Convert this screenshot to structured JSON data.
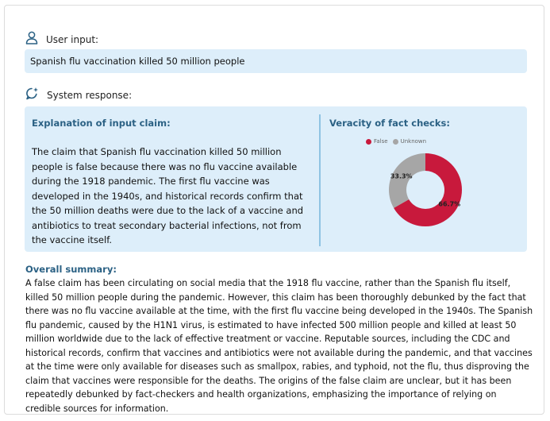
{
  "user": {
    "label": "User input:",
    "claim": "Spanish flu vaccination killed 50 million people"
  },
  "system": {
    "label": "System response:"
  },
  "explanation": {
    "title": "Explanation of input claim:",
    "text": "The claim that Spanish flu vaccination killed 50 million people is false because there was no flu vaccine available during the 1918 pandemic. The first flu vaccine was developed in the 1940s, and historical records confirm that the 50 million deaths were due to the lack of a vaccine and antibiotics to treat secondary bacterial infections, not from the vaccine itself."
  },
  "veracity": {
    "title": "Veracity of fact checks:"
  },
  "chart_data": {
    "type": "pie",
    "donut": true,
    "categories": [
      "False",
      "Unknown"
    ],
    "values": [
      66.7,
      33.3
    ],
    "labels": [
      "66.7%",
      "33.3%"
    ],
    "colors": [
      "#c8193c",
      "#a6a6a6"
    ],
    "legend": "top"
  },
  "summary": {
    "title": "Overall summary:",
    "text": "A false claim has been circulating on social media that the 1918 flu vaccine, rather than the Spanish flu itself, killed 50 million people during the pandemic. However, this claim has been thoroughly debunked by the fact that there was no flu vaccine available at the time, with the first flu vaccine being developed in the 1940s. The Spanish flu pandemic, caused by the H1N1 virus, is estimated to have infected 500 million people and killed at least 50 million worldwide due to the lack of effective treatment or vaccine. Reputable sources, including the CDC and historical records, confirm that vaccines and antibiotics were not available during the pandemic, and that vaccines at the time were only available for diseases such as smallpox, rabies, and typhoid, not the flu, thus disproving the claim that vaccines were responsible for the deaths. The origins of the false claim are unclear, but it has been repeatedly debunked by fact-checkers and health organizations, emphasizing the importance of relying on credible sources for information."
  },
  "icons": {
    "user": "user-icon",
    "system": "chat-sparkle-icon"
  }
}
